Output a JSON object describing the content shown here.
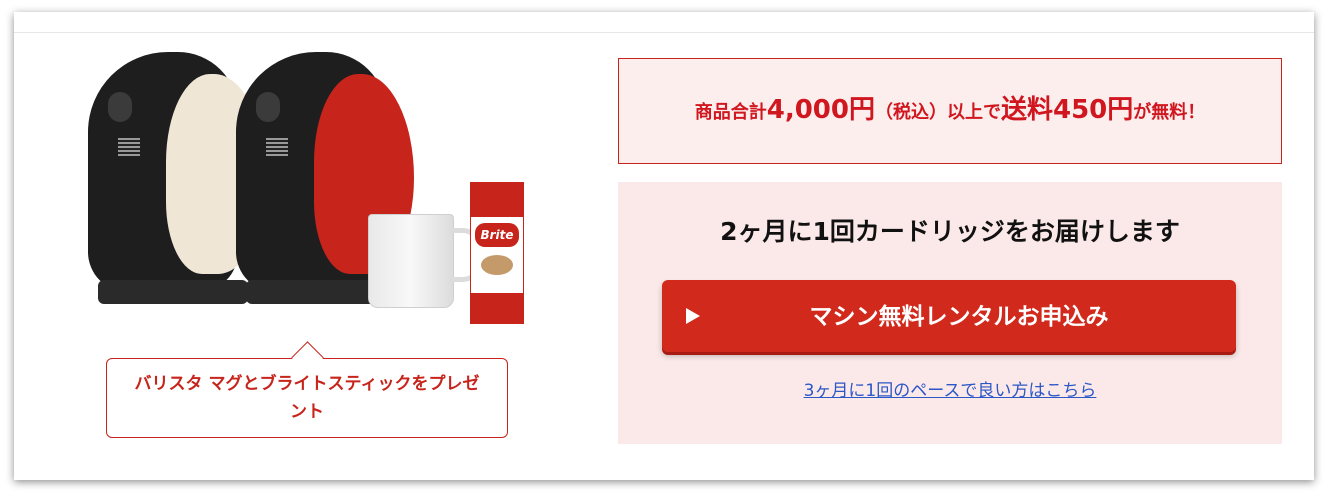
{
  "shipping_banner": {
    "prefix": "商品合計",
    "amount": "4,000円",
    "tax_note": "（税込）以上で",
    "fee": "送料450円",
    "suffix": "が無料！"
  },
  "promo": {
    "callout": "バリスタ マグとブライトスティックをプレゼント",
    "brite_logo": "Brite"
  },
  "subscription": {
    "title": "2ヶ月に1回カードリッジをお届けします",
    "apply_button": "マシン無料レンタルお申込み",
    "alt_link": "3ヶ月に1回のペースで良い方はこちら"
  },
  "colors": {
    "accent": "#d2291d",
    "banner_bg": "#fdeeee",
    "link": "#2b57c7"
  }
}
